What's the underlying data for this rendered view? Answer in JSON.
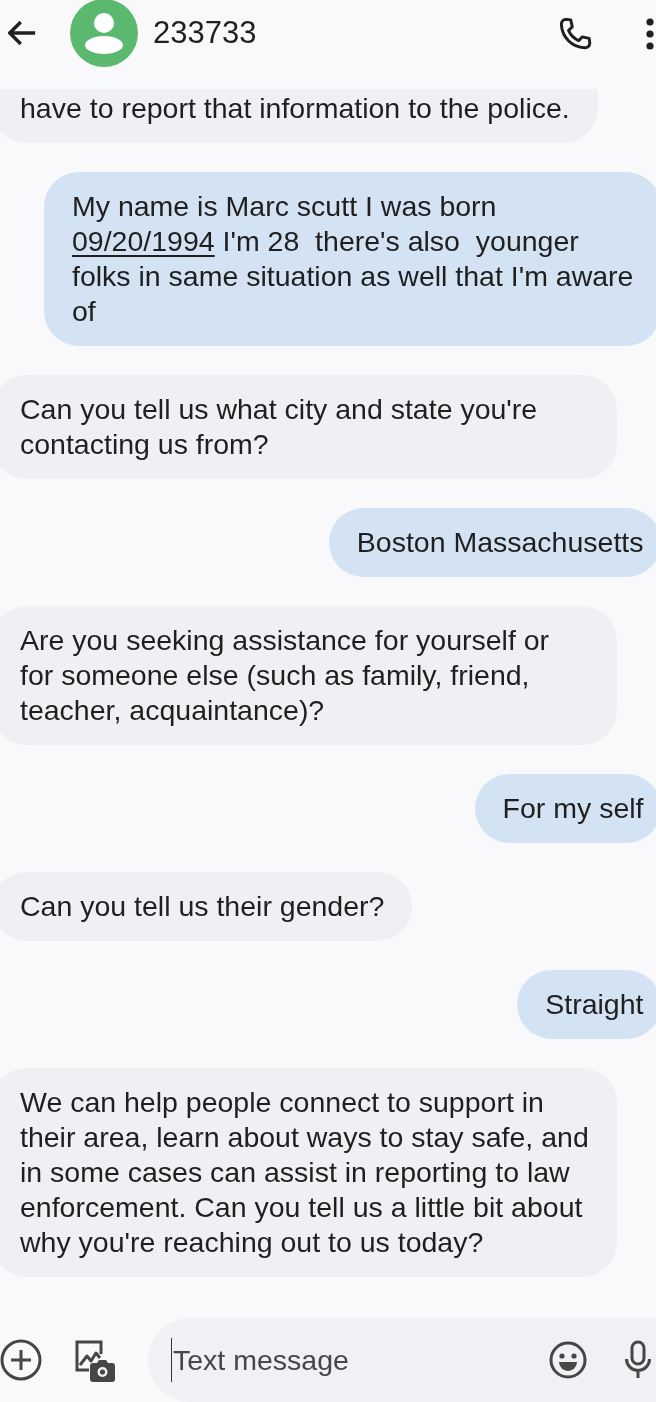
{
  "header": {
    "title": "233733"
  },
  "messages": [
    {
      "kind": "incoming",
      "parts": [
        {
          "kind": "plain",
          "text": "have to report that information to the police."
        }
      ]
    },
    {
      "kind": "outgoing",
      "parts": [
        {
          "kind": "plain",
          "text": "My name is Marc scutt I was born "
        },
        {
          "kind": "link",
          "text": "09/20/1994"
        },
        {
          "kind": "plain",
          "text": " I'm 28  there's also  younger folks in same situation as well that I'm aware of"
        }
      ]
    },
    {
      "kind": "incoming",
      "parts": [
        {
          "kind": "plain",
          "text": "Can you tell us what city and state you're contacting us from?"
        }
      ]
    },
    {
      "kind": "outgoing",
      "parts": [
        {
          "kind": "plain",
          "text": "Boston Massachusetts"
        }
      ]
    },
    {
      "kind": "incoming",
      "parts": [
        {
          "kind": "plain",
          "text": "Are you seeking assistance for yourself or for someone else (such as family, friend, teacher, acquaintance)?"
        }
      ]
    },
    {
      "kind": "outgoing",
      "parts": [
        {
          "kind": "plain",
          "text": "For my self"
        }
      ]
    },
    {
      "kind": "incoming",
      "parts": [
        {
          "kind": "plain",
          "text": "Can you tell us their gender?"
        }
      ]
    },
    {
      "kind": "outgoing",
      "parts": [
        {
          "kind": "plain",
          "text": "Straight"
        }
      ]
    },
    {
      "kind": "incoming",
      "parts": [
        {
          "kind": "plain",
          "text": "We can help people connect to support in their area, learn about ways to stay safe, and in some cases can assist in reporting to law enforcement. Can you tell us a little bit about why you're reaching out to us today?"
        }
      ]
    }
  ],
  "composer": {
    "placeholder": "Text message"
  }
}
